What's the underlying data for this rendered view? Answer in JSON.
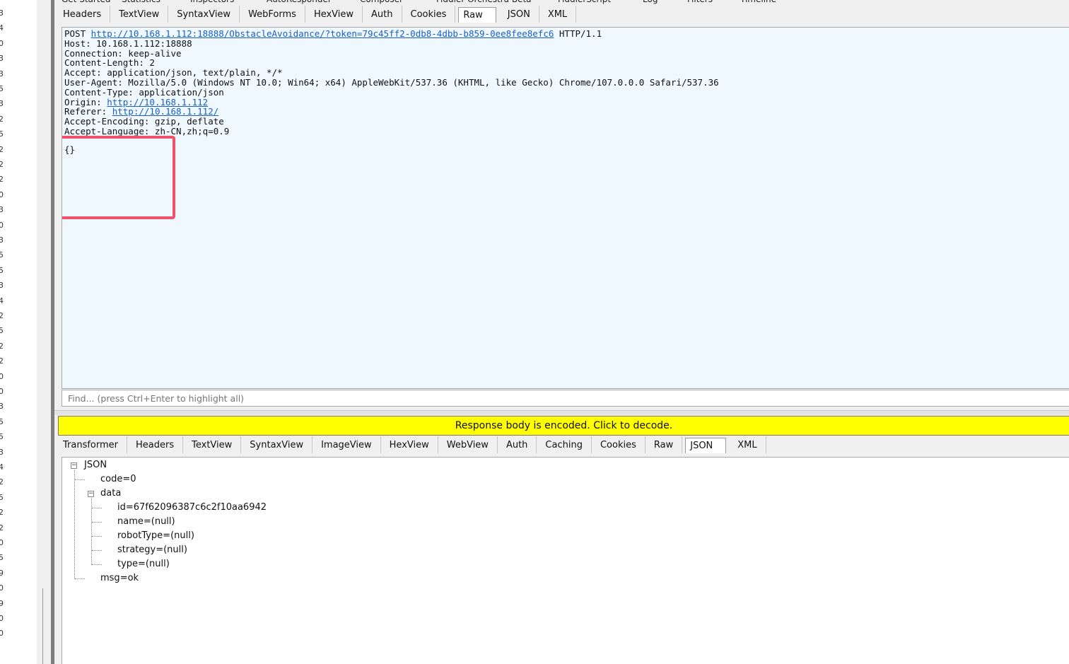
{
  "left_numbers": [
    "3",
    "4",
    "0",
    "3",
    "3",
    "5",
    "3",
    "2",
    "5",
    "2",
    "2",
    "2",
    "0",
    "3",
    "0",
    "3",
    "5",
    "5",
    "3",
    "4",
    "2",
    "5",
    "2",
    "2",
    "0",
    "0",
    "3",
    "5",
    "5",
    "3",
    "4",
    "2",
    "5",
    "2",
    "2",
    "0",
    "5",
    "9",
    "0",
    "9",
    "0",
    "0"
  ],
  "top_tabs": [
    "Get Started",
    "Statistics",
    "Inspectors",
    "AutoResponder",
    "Composer",
    "Fiddler Orchestra Beta",
    "FiddlerScript",
    "Log",
    "Filters",
    "Timeline"
  ],
  "request_tabs": [
    "Headers",
    "TextView",
    "SyntaxView",
    "WebForms",
    "HexView",
    "Auth",
    "Cookies",
    "Raw",
    "JSON",
    "XML"
  ],
  "request_selected": "Raw",
  "request": {
    "method": "POST",
    "url": "http://10.168.1.112:18888/ObstacleAvoidance/?token=79c45ff2-0db8-4dbb-b859-0ee8fee8efc6",
    "protocol": "HTTP/1.1",
    "host_line": "Host: 10.168.1.112:18888",
    "connection_line": "Connection: keep-alive",
    "content_length_line": "Content-Length: 2",
    "accept_line": "Accept: application/json, text/plain, */*",
    "user_agent_line": "User-Agent: Mozilla/5.0 (Windows NT 10.0; Win64; x64) AppleWebKit/537.36 (KHTML, like Gecko) Chrome/107.0.0.0 Safari/537.36",
    "content_type_line": "Content-Type: application/json",
    "origin_label": "Origin: ",
    "origin_url": "http://10.168.1.112",
    "referer_label": "Referer: ",
    "referer_url": "http://10.168.1.112/",
    "accept_encoding_line": "Accept-Encoding: gzip, deflate",
    "accept_language_line": "Accept-Language: zh-CN,zh;q=0.9",
    "body": "{}"
  },
  "find": {
    "placeholder": "Find... (press Ctrl+Enter to highlight all)"
  },
  "banner": "Response body is encoded. Click to decode.",
  "response_tabs": [
    "Transformer",
    "Headers",
    "TextView",
    "SyntaxView",
    "ImageView",
    "HexView",
    "WebView",
    "Auth",
    "Caching",
    "Cookies",
    "Raw",
    "JSON",
    "XML"
  ],
  "response_selected": "JSON",
  "json_tree": {
    "root": "JSON",
    "code": "code=0",
    "data": "data",
    "id": "id=67f62096387c6c2f10aa6942",
    "name": "name=(null)",
    "robotType": "robotType=(null)",
    "strategy": "strategy=(null)",
    "type": "type=(null)",
    "msg": "msg=ok"
  },
  "colors": {
    "banner": "#ffff00",
    "highlight": "#f0516a",
    "link": "#1a5ec9",
    "raw_bg": "#eff8ff"
  }
}
